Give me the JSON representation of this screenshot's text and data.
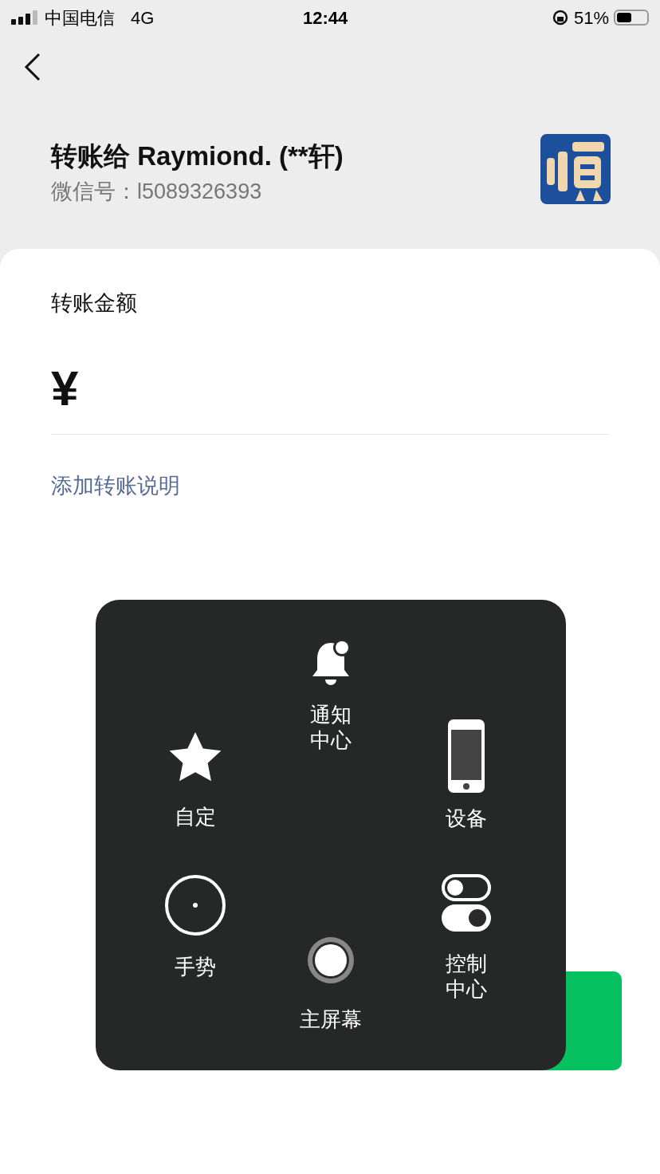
{
  "status_bar": {
    "carrier": "中国电信",
    "network": "4G",
    "time": "12:44",
    "battery": "51%"
  },
  "header": {
    "title": "转账给 Raymiond. (**轩)",
    "wechat_id": "微信号：l5089326393"
  },
  "form": {
    "amount_label": "转账金额",
    "currency": "¥",
    "add_note_link": "添加转账说明"
  },
  "assistive_menu": {
    "items": [
      {
        "kind": "notifications",
        "label": "通知中心"
      },
      {
        "kind": "custom",
        "label": "自定"
      },
      {
        "kind": "device",
        "label": "设备"
      },
      {
        "kind": "gestures",
        "label": "手势"
      },
      {
        "kind": "home",
        "label": "主屏幕"
      },
      {
        "kind": "control",
        "label": "控制中心"
      }
    ]
  }
}
